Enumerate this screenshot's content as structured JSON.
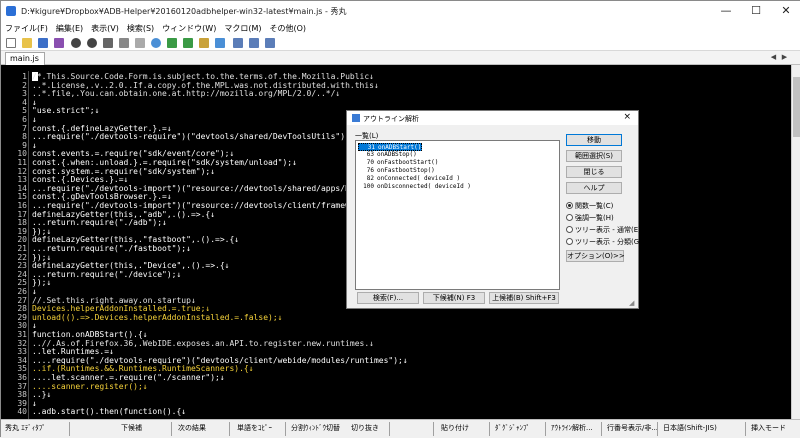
{
  "window": {
    "title": "D:¥kigure¥Dropbox¥ADB-Helper¥20160120adbhelper-win32-latest¥main.js - 秀丸",
    "minimize": "—",
    "maximize": "☐",
    "close": "✕"
  },
  "menu": [
    "ファイル(F)",
    "編集(E)",
    "表示(V)",
    "検索(S)",
    "ウィンドウ(W)",
    "マクロ(M)",
    "その他(O)"
  ],
  "tab": {
    "label": "main.js"
  },
  "editor": {
    "lines": [
      {
        "n": "1",
        "t": "/*.This.Source.Code.Form.is.subject.to.the.terms.of.the.Mozilla.Public↓"
      },
      {
        "n": "2",
        "t": "..*.License,.v..2.0..If.a.copy.of.the.MPL.was.not.distributed.with.this↓"
      },
      {
        "n": "3",
        "t": "..*.file,.You.can.obtain.one.at.http://mozilla.org/MPL/2.0/..*/↓"
      },
      {
        "n": "4",
        "t": "↓"
      },
      {
        "n": "5",
        "t": "\"use.strict\";↓"
      },
      {
        "n": "6",
        "t": "↓"
      },
      {
        "n": "7",
        "t": "const.{.defineLazyGetter.}.=↓"
      },
      {
        "n": "8",
        "t": "...require(\"./devtools-require\")(\"devtools/shared/DevToolsUtils\");↓"
      },
      {
        "n": "9",
        "t": "↓"
      },
      {
        "n": "10",
        "t": "const.events.=.require(\"sdk/event/core\");↓"
      },
      {
        "n": "11",
        "t": "const.{.when:.unload.}.=.require(\"sdk/system/unload\");↓"
      },
      {
        "n": "12",
        "t": "const.system.=.require(\"sdk/system\");↓"
      },
      {
        "n": "13",
        "t": "const.{.Devices.}.=↓"
      },
      {
        "n": "14",
        "t": "...require(\"./devtools-import\")(\"resource://devtools/shared/apps/Devices"
      },
      {
        "n": "15",
        "t": "const.{.gDevToolsBrowser.}.=↓"
      },
      {
        "n": "16",
        "t": "...require(\"./devtools-import\")(\"resource://devtools/client/framework/gD"
      },
      {
        "n": "17",
        "t": "defineLazyGetter(this,.\"adb\",.().=>.{↓"
      },
      {
        "n": "18",
        "t": "...return.require(\"./adb\");↓"
      },
      {
        "n": "19",
        "t": "});↓"
      },
      {
        "n": "20",
        "t": "defineLazyGetter(this,.\"fastboot\",.().=>.{↓"
      },
      {
        "n": "21",
        "t": "...return.require(\"./fastboot\");↓"
      },
      {
        "n": "22",
        "t": "});↓"
      },
      {
        "n": "23",
        "t": "defineLazyGetter(this,.\"Device\",.().=>.{↓"
      },
      {
        "n": "24",
        "t": "...return.require(\"./device\");↓"
      },
      {
        "n": "25",
        "t": "});↓"
      },
      {
        "n": "26",
        "t": "↓"
      },
      {
        "n": "27",
        "t": "//.Set.this.right.away.on.startup↓"
      },
      {
        "n": "28",
        "t": "Devices.helperAddonInstalled.=.true;↓"
      },
      {
        "n": "29",
        "t": "unload(().=>.Devices.helperAddonInstalled.=.false);↓"
      },
      {
        "n": "30",
        "t": "↓"
      },
      {
        "n": "31",
        "t": "function.onADBStart().{↓"
      },
      {
        "n": "32",
        "t": "..//.As.of.Firefox.36,.WebIDE.exposes.an.API.to.register.new.runtimes.↓"
      },
      {
        "n": "33",
        "t": "..let.Runtimes.=↓"
      },
      {
        "n": "34",
        "t": "....require(\"./devtools-require\")(\"devtools/client/webide/modules/runtimes\");↓"
      },
      {
        "n": "35",
        "t": "..if.(Runtimes.&&.Runtimes.RuntimeScanners).{↓"
      },
      {
        "n": "36",
        "t": "....let.scanner.=.require(\"./scanner\");↓"
      },
      {
        "n": "37",
        "t": "....scanner.register();↓"
      },
      {
        "n": "38",
        "t": "..}↓"
      },
      {
        "n": "39",
        "t": "↓"
      },
      {
        "n": "40",
        "t": "..adb.start().then(function().{↓"
      }
    ]
  },
  "status": {
    "keys": [
      "秀丸 ｴﾃﾞｨﾀﾌﾟ",
      "下候補",
      "次の結果",
      "単語をｺﾋﾟｰ",
      "分割ｳｨﾝﾄﾞｳ切替",
      "切り抜き",
      "",
      "貼り付け",
      "ﾀﾞｸﾞｼﾞｬﾝﾌﾟ",
      "ｱｳﾄﾗｲﾝ解析...",
      "行番号表示/非..."
    ],
    "encoding": "日本語(Shift-JIS)",
    "mode": "挿入モード"
  },
  "dialog": {
    "title": "アウトライン解析",
    "close": "×",
    "list_label": "一覧(L)",
    "items": [
      {
        "line": "31",
        "name": "onADBStart()",
        "selected": true
      },
      {
        "line": "63",
        "name": "onADBStop()",
        "selected": false
      },
      {
        "line": "70",
        "name": "onFastbootStart()",
        "selected": false
      },
      {
        "line": "76",
        "name": "onFastbootStop()",
        "selected": false
      },
      {
        "line": "82",
        "name": "onConnected( deviceId )",
        "selected": false
      },
      {
        "line": "100",
        "name": "onDisconnected( deviceId )",
        "selected": false
      }
    ],
    "buttons": {
      "move": "移動",
      "range": "範囲選択(S)",
      "close": "閉じる",
      "help": "ヘルプ",
      "options": "オプション(O)>>",
      "search": "検索(F)...",
      "down": "下候補(N) F3",
      "up": "上候補(B) Shift+F3"
    },
    "radios": [
      {
        "label": "関数一覧(C)",
        "checked": true
      },
      {
        "label": "強調一覧(H)",
        "checked": false
      },
      {
        "label": "ツリー表示 - 通常(E)",
        "checked": false
      },
      {
        "label": "ツリー表示 - 分類(G)",
        "checked": false
      }
    ]
  }
}
